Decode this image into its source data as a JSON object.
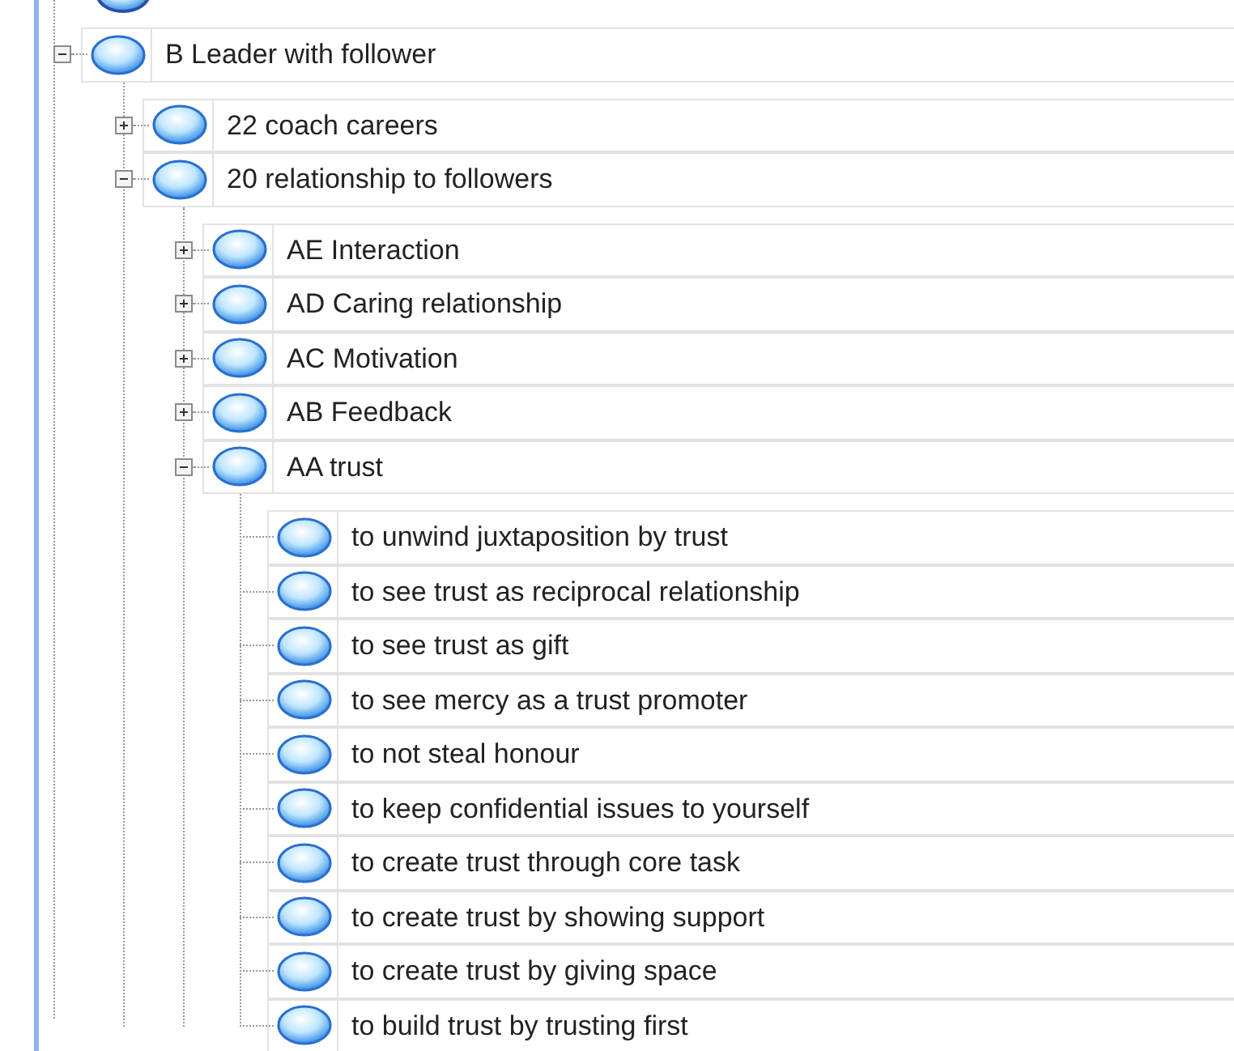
{
  "tree": [
    {
      "label": "B Leader with follower",
      "expanded": true,
      "children": [
        {
          "label": "22 coach careers",
          "expanded": false
        },
        {
          "label": "20 relationship to followers",
          "expanded": true,
          "children": [
            {
              "label": "AE Interaction",
              "expanded": false
            },
            {
              "label": "AD Caring relationship",
              "expanded": false
            },
            {
              "label": "AC Motivation",
              "expanded": false
            },
            {
              "label": "AB Feedback",
              "expanded": false
            },
            {
              "label": "AA trust",
              "expanded": true,
              "children": [
                {
                  "label": "to unwind juxtaposition by trust"
                },
                {
                  "label": "to see trust as reciprocal relationship"
                },
                {
                  "label": "to see trust as gift"
                },
                {
                  "label": "to see mercy as a trust promoter"
                },
                {
                  "label": "to not steal honour"
                },
                {
                  "label": "to keep confidential issues to yourself"
                },
                {
                  "label": "to create trust through core task"
                },
                {
                  "label": "to create trust by showing support"
                },
                {
                  "label": "to create trust by giving space"
                },
                {
                  "label": "to build trust by trusting first"
                }
              ]
            }
          ]
        }
      ]
    }
  ]
}
